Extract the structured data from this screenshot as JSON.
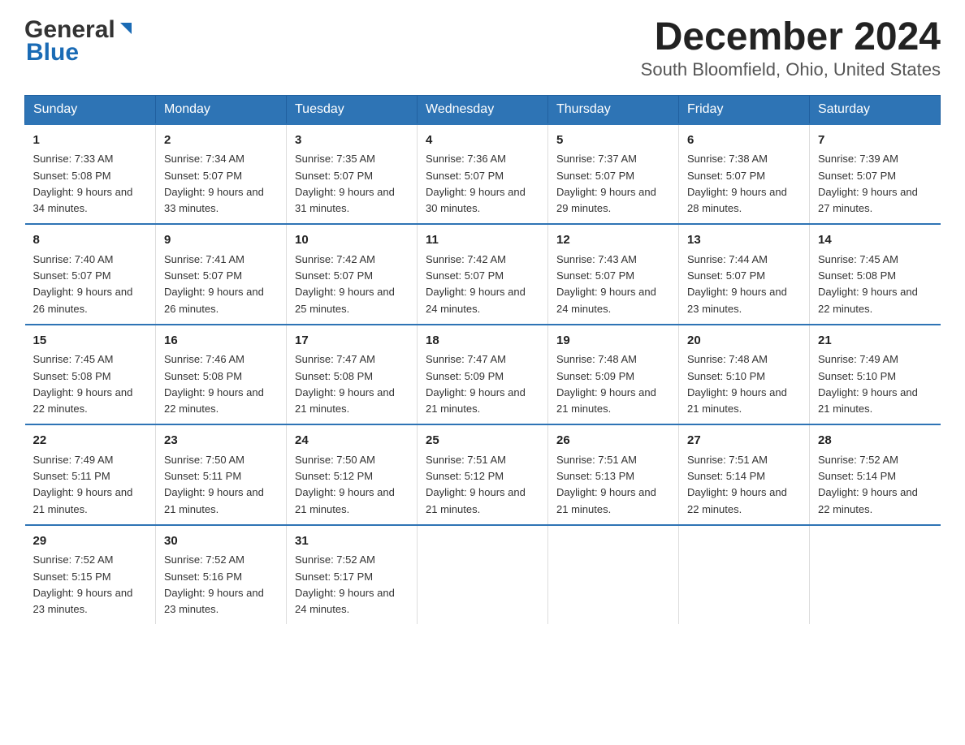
{
  "header": {
    "logo_general": "General",
    "logo_blue": "Blue",
    "title": "December 2024",
    "subtitle": "South Bloomfield, Ohio, United States"
  },
  "weekdays": [
    "Sunday",
    "Monday",
    "Tuesday",
    "Wednesday",
    "Thursday",
    "Friday",
    "Saturday"
  ],
  "weeks": [
    [
      {
        "day": "1",
        "sunrise": "7:33 AM",
        "sunset": "5:08 PM",
        "daylight": "9 hours and 34 minutes."
      },
      {
        "day": "2",
        "sunrise": "7:34 AM",
        "sunset": "5:07 PM",
        "daylight": "9 hours and 33 minutes."
      },
      {
        "day": "3",
        "sunrise": "7:35 AM",
        "sunset": "5:07 PM",
        "daylight": "9 hours and 31 minutes."
      },
      {
        "day": "4",
        "sunrise": "7:36 AM",
        "sunset": "5:07 PM",
        "daylight": "9 hours and 30 minutes."
      },
      {
        "day": "5",
        "sunrise": "7:37 AM",
        "sunset": "5:07 PM",
        "daylight": "9 hours and 29 minutes."
      },
      {
        "day": "6",
        "sunrise": "7:38 AM",
        "sunset": "5:07 PM",
        "daylight": "9 hours and 28 minutes."
      },
      {
        "day": "7",
        "sunrise": "7:39 AM",
        "sunset": "5:07 PM",
        "daylight": "9 hours and 27 minutes."
      }
    ],
    [
      {
        "day": "8",
        "sunrise": "7:40 AM",
        "sunset": "5:07 PM",
        "daylight": "9 hours and 26 minutes."
      },
      {
        "day": "9",
        "sunrise": "7:41 AM",
        "sunset": "5:07 PM",
        "daylight": "9 hours and 26 minutes."
      },
      {
        "day": "10",
        "sunrise": "7:42 AM",
        "sunset": "5:07 PM",
        "daylight": "9 hours and 25 minutes."
      },
      {
        "day": "11",
        "sunrise": "7:42 AM",
        "sunset": "5:07 PM",
        "daylight": "9 hours and 24 minutes."
      },
      {
        "day": "12",
        "sunrise": "7:43 AM",
        "sunset": "5:07 PM",
        "daylight": "9 hours and 24 minutes."
      },
      {
        "day": "13",
        "sunrise": "7:44 AM",
        "sunset": "5:07 PM",
        "daylight": "9 hours and 23 minutes."
      },
      {
        "day": "14",
        "sunrise": "7:45 AM",
        "sunset": "5:08 PM",
        "daylight": "9 hours and 22 minutes."
      }
    ],
    [
      {
        "day": "15",
        "sunrise": "7:45 AM",
        "sunset": "5:08 PM",
        "daylight": "9 hours and 22 minutes."
      },
      {
        "day": "16",
        "sunrise": "7:46 AM",
        "sunset": "5:08 PM",
        "daylight": "9 hours and 22 minutes."
      },
      {
        "day": "17",
        "sunrise": "7:47 AM",
        "sunset": "5:08 PM",
        "daylight": "9 hours and 21 minutes."
      },
      {
        "day": "18",
        "sunrise": "7:47 AM",
        "sunset": "5:09 PM",
        "daylight": "9 hours and 21 minutes."
      },
      {
        "day": "19",
        "sunrise": "7:48 AM",
        "sunset": "5:09 PM",
        "daylight": "9 hours and 21 minutes."
      },
      {
        "day": "20",
        "sunrise": "7:48 AM",
        "sunset": "5:10 PM",
        "daylight": "9 hours and 21 minutes."
      },
      {
        "day": "21",
        "sunrise": "7:49 AM",
        "sunset": "5:10 PM",
        "daylight": "9 hours and 21 minutes."
      }
    ],
    [
      {
        "day": "22",
        "sunrise": "7:49 AM",
        "sunset": "5:11 PM",
        "daylight": "9 hours and 21 minutes."
      },
      {
        "day": "23",
        "sunrise": "7:50 AM",
        "sunset": "5:11 PM",
        "daylight": "9 hours and 21 minutes."
      },
      {
        "day": "24",
        "sunrise": "7:50 AM",
        "sunset": "5:12 PM",
        "daylight": "9 hours and 21 minutes."
      },
      {
        "day": "25",
        "sunrise": "7:51 AM",
        "sunset": "5:12 PM",
        "daylight": "9 hours and 21 minutes."
      },
      {
        "day": "26",
        "sunrise": "7:51 AM",
        "sunset": "5:13 PM",
        "daylight": "9 hours and 21 minutes."
      },
      {
        "day": "27",
        "sunrise": "7:51 AM",
        "sunset": "5:14 PM",
        "daylight": "9 hours and 22 minutes."
      },
      {
        "day": "28",
        "sunrise": "7:52 AM",
        "sunset": "5:14 PM",
        "daylight": "9 hours and 22 minutes."
      }
    ],
    [
      {
        "day": "29",
        "sunrise": "7:52 AM",
        "sunset": "5:15 PM",
        "daylight": "9 hours and 23 minutes."
      },
      {
        "day": "30",
        "sunrise": "7:52 AM",
        "sunset": "5:16 PM",
        "daylight": "9 hours and 23 minutes."
      },
      {
        "day": "31",
        "sunrise": "7:52 AM",
        "sunset": "5:17 PM",
        "daylight": "9 hours and 24 minutes."
      },
      null,
      null,
      null,
      null
    ]
  ]
}
